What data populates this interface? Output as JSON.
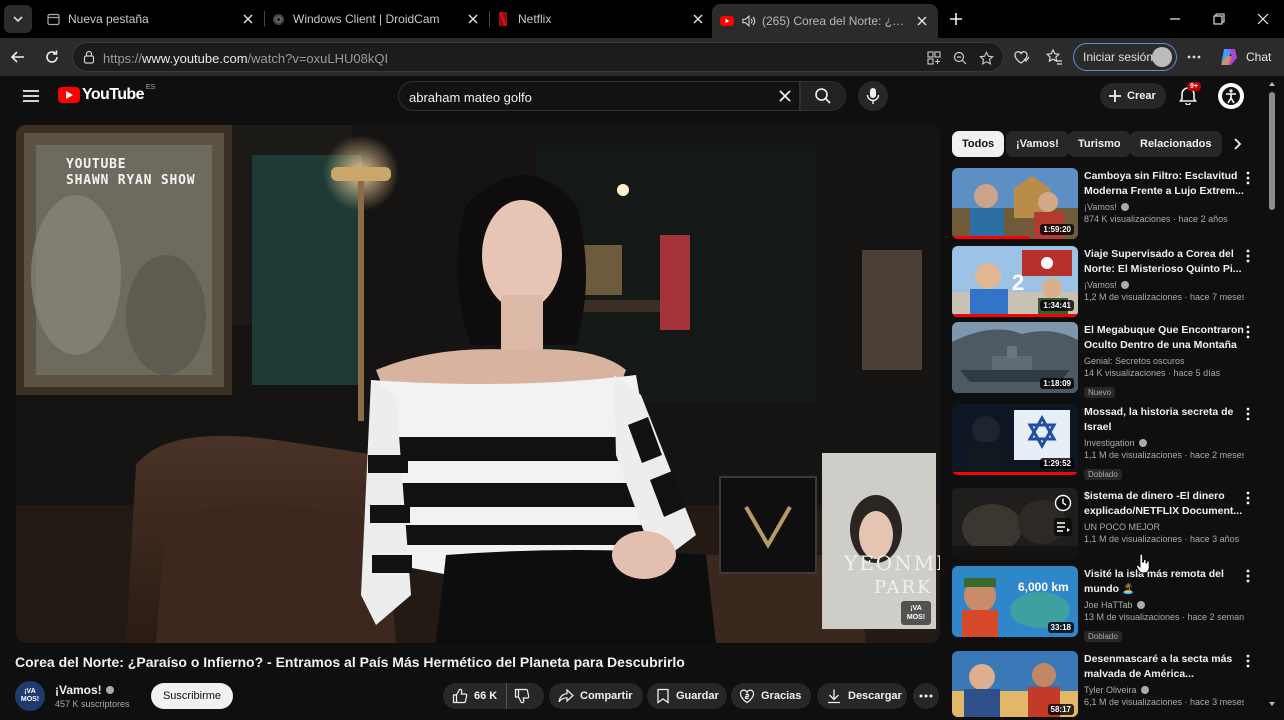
{
  "browser": {
    "tabs": [
      {
        "title": "Nueva pestaña",
        "icon": "page-icon"
      },
      {
        "title": "Windows Client | DroidCam",
        "icon": "droidcam-icon"
      },
      {
        "title": "Netflix",
        "icon": "netflix-icon"
      },
      {
        "title": "(265) Corea del Norte: ¿Paraíso",
        "icon": "youtube-icon",
        "active": true,
        "audio": true
      }
    ],
    "url_prefix": "https://",
    "url_host": "www.youtube.com",
    "url_path": "/watch?v=oxuLHU08kQI",
    "signin_label": "Iniciar sesión",
    "chat_label": "Chat"
  },
  "youtube": {
    "logo_text": "YouTube",
    "country_code": "ES",
    "search_query": "abraham mateo golfo",
    "create_label": "Crear",
    "notifications_badge": "9+"
  },
  "video": {
    "overlay_line1": "YOUTUBE",
    "overlay_line2": "SHAWN RYAN SHOW",
    "book_line1": "YEONMI",
    "book_line2": "PARK",
    "corner_badge": "¡VA MOS!",
    "title": "Corea del Norte: ¿Paraíso o Infierno? - Entramos al País Más Hermético del Planeta para Descubrirlo",
    "channel": "¡Vamos!",
    "channel_avatar_text": "¡VA MOS!",
    "subscribers": "457 K suscriptores",
    "subscribe_label": "Suscribirme",
    "likes": "66 K",
    "share_label": "Compartir",
    "save_label": "Guardar",
    "thanks_label": "Gracias",
    "download_label": "Descargar"
  },
  "chips": [
    "Todos",
    "¡Vamos!",
    "Turismo",
    "Relacionados"
  ],
  "recommendations": [
    {
      "title": "Camboya sin Filtro: Esclavitud Moderna Frente a Lujo Extrem...",
      "channel": "¡Vamos!",
      "verified": true,
      "stats": "874 K visualizaciones · hace 2 años",
      "duration": "1:59:20",
      "progress": 0.62,
      "tag": ""
    },
    {
      "title": "Viaje Supervisado a Corea del Norte: El Misterioso Quinto Pi...",
      "channel": "¡Vamos!",
      "verified": true,
      "stats": "1,2 M de visualizaciones · hace 7 meses",
      "duration": "1:34:41",
      "progress": 1.0,
      "tag": ""
    },
    {
      "title": "El Megabuque Que Encontraron Oculto Dentro de una Montaña",
      "channel": "Genial: Secretos oscuros",
      "verified": false,
      "stats": "14 K visualizaciones · hace 5 días",
      "duration": "1:18:09",
      "progress": 0.0,
      "tag": "Nuevo"
    },
    {
      "title": "Mossad, la historia secreta de Israel",
      "channel": "Investigation",
      "verified": true,
      "stats": "1,1 M de visualizaciones · hace 2 meses",
      "duration": "1:29:52",
      "progress": 1.0,
      "tag": "Doblado"
    },
    {
      "title": "$istema de dinero -El dinero explicado/NETFLIX Document...",
      "channel": "UN POCO MEJOR",
      "verified": false,
      "stats": "1,1 M de visualizaciones · hace 3 años",
      "duration": "",
      "progress": 0.0,
      "tag": ""
    },
    {
      "title": "Visité la isla más remota del mundo 🏝️",
      "channel": "Joe HaTTab",
      "verified": true,
      "stats": "13 M de visualizaciones · hace 2 seman...",
      "duration": "33:18",
      "progress": 0.0,
      "tag": "Doblado"
    },
    {
      "title": "Desenmascaré a la secta más malvada de América...",
      "channel": "Tyler Oliveira",
      "verified": true,
      "stats": "6,1 M de visualizaciones · hace 3 meses",
      "duration": "58:17",
      "progress": 0.0,
      "tag": ""
    }
  ],
  "thumb_overlays": {
    "km_label": "6,000 km",
    "badge_2": "2"
  }
}
